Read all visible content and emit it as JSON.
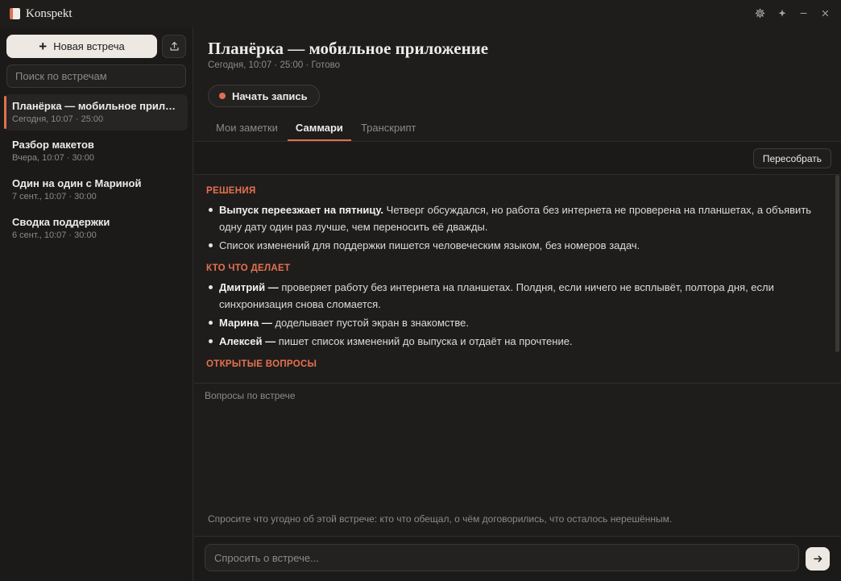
{
  "app": {
    "title": "Konspekt"
  },
  "window": {
    "settings_icon": "gear-icon",
    "pin_icon": "pin-icon",
    "minimize_icon": "minimize-icon",
    "close_icon": "close-icon"
  },
  "sidebar": {
    "new_meeting_label": "Новая встреча",
    "export_icon": "upload-icon",
    "search_placeholder": "Поиск по встречам",
    "meetings": [
      {
        "title": "Планёрка — мобильное приложение",
        "meta": "Сегодня, 10:07 · 25:00",
        "active": true
      },
      {
        "title": "Разбор макетов",
        "meta": "Вчера, 10:07 · 30:00",
        "active": false
      },
      {
        "title": "Один на один с Мариной",
        "meta": "7 сент., 10:07 · 30:00",
        "active": false
      },
      {
        "title": "Сводка поддержки",
        "meta": "6 сент., 10:07 · 30:00",
        "active": false
      }
    ]
  },
  "main": {
    "title": "Планёрка — мобильное приложение",
    "meta": "Сегодня, 10:07 · 25:00 · Готово",
    "record_label": "Начать запись",
    "tabs": [
      {
        "label": "Мои заметки",
        "active": false
      },
      {
        "label": "Саммари",
        "active": true
      },
      {
        "label": "Транскрипт",
        "active": false
      }
    ],
    "rebuild_label": "Пересобрать",
    "summary": {
      "decisions_heading": "РЕШЕНИЯ",
      "decisions": [
        {
          "bold": "Выпуск переезжает на пятницу.",
          "text": " Четверг обсуждался, но работа без интернета не проверена на планшетах, а объявить одну дату один раз лучше, чем переносить её дважды."
        },
        {
          "bold": "",
          "text": "Список изменений для поддержки пишется человеческим языком, без номеров задач."
        }
      ],
      "who_heading": "КТО ЧТО ДЕЛАЕТ",
      "who": [
        {
          "bold": "Дмитрий —",
          "text": " проверяет работу без интернета на планшетах. Полдня, если ничего не всплывёт, полтора дня, если синхронизация снова сломается."
        },
        {
          "bold": "Марина —",
          "text": " доделывает пустой экран в знакомстве."
        },
        {
          "bold": "Алексей —",
          "text": " пишет список изменений до выпуска и отдаёт на прочтение."
        }
      ],
      "open_heading": "ОТКРЫТЫЕ ВОПРОСЫ"
    },
    "qa": {
      "label": "Вопросы по встрече",
      "hint": "Спросите что угодно об этой встрече: кто что обещал, о чём договорились, что осталось нерешённым.",
      "input_placeholder": "Спросить о встрече...",
      "send_icon": "arrow-right-icon"
    }
  },
  "colors": {
    "accent": "#e07050",
    "background": "#1e1d1c",
    "sidebar": "#1b1a19"
  }
}
